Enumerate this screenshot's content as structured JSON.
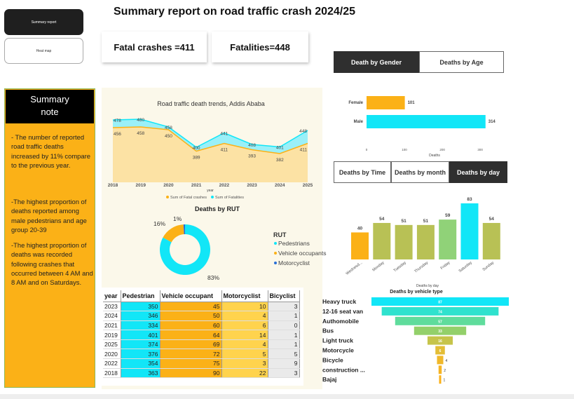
{
  "nav": {
    "summary_label": "Summary report",
    "heatmap_label": "Heat map"
  },
  "title": "Summary report on road traffic crash 2024/25",
  "cards": {
    "fatal_crashes": "Fatal crashes =411",
    "fatalities": "Fatalities=448"
  },
  "tabs_gender_age": {
    "gender": "Death by Gender",
    "age": "Deaths by Age"
  },
  "tabs_time": {
    "time": "Deaths by Time",
    "month": "Deaths by month",
    "day": "Deaths by day"
  },
  "summary": {
    "heading": "Summary note",
    "p1": "- The number of reported road traffic deaths increased by 11% compare to the previous year.",
    "p2": "-The highest proportion of deaths reported among male pedestrians and age group 20-39",
    "p3": "-The highest proportion of deaths was recorded following crashes that occurred between 4 AM and 8 AM and on Saturdays."
  },
  "colors": {
    "cyan": "#12e6f7",
    "amber": "#fbb117",
    "olive": "#b8c155",
    "green": "#90d278"
  },
  "chart_data": [
    {
      "type": "area",
      "title": "Road traffic death trends, Addis Ababa",
      "xlabel": "year",
      "x": [
        "2018",
        "2019",
        "2020",
        "2021",
        "2022",
        "2023",
        "2024",
        "2025"
      ],
      "series": [
        {
          "name": "Sum of Fatal crashes",
          "values": [
            456,
            458,
            450,
            389,
            411,
            393,
            382,
            411
          ]
        },
        {
          "name": "Sum of Fatalities",
          "values": [
            478,
            480,
            458,
            400,
            441,
            408,
            401,
            448
          ]
        }
      ],
      "legend": "bottom"
    },
    {
      "type": "pie",
      "title": "Deaths by RUT",
      "legend_title": "RUT",
      "categories": [
        "Pedestrians",
        "Vehicle occupants",
        "Motorcyclist"
      ],
      "values": [
        83,
        16,
        1
      ],
      "labels": [
        "83%",
        "16%",
        "1%"
      ]
    },
    {
      "type": "bar",
      "orientation": "horizontal",
      "categories": [
        "Female",
        "Male"
      ],
      "values": [
        101,
        314
      ],
      "xlabel": "Deaths",
      "xticks": [
        "0",
        "100",
        "200",
        "300"
      ],
      "xlim": [
        0,
        320
      ]
    },
    {
      "type": "bar",
      "xlabel": "Deaths by day",
      "categories": [
        "Wednesd...",
        "Monday",
        "Tuesday",
        "Thursday",
        "Friday",
        "Saturday",
        "Sunday"
      ],
      "values": [
        40,
        54,
        51,
        51,
        59,
        83,
        54
      ]
    },
    {
      "type": "bar",
      "orientation": "funnel",
      "title": "Deaths by vehicle type",
      "categories": [
        "Heavy truck",
        "12-16 seat van",
        "Authomobile",
        "Bus",
        "Light truck",
        "Motorcycle",
        "Bicycle",
        "construction ...",
        "Bajaj"
      ],
      "values": [
        87,
        74,
        57,
        33,
        16,
        6,
        4,
        2,
        1
      ]
    },
    {
      "type": "table",
      "columns": [
        "year",
        "Pedestrian",
        "Vehicle occupant",
        "Motorcyclist",
        "Bicyclist"
      ],
      "rows": [
        [
          "2023",
          "350",
          "45",
          "10",
          "3"
        ],
        [
          "2024",
          "346",
          "50",
          "4",
          "1"
        ],
        [
          "2021",
          "334",
          "60",
          "6",
          "0"
        ],
        [
          "2019",
          "401",
          "64",
          "14",
          "1"
        ],
        [
          "2025",
          "374",
          "69",
          "4",
          "1"
        ],
        [
          "2020",
          "376",
          "72",
          "5",
          "5"
        ],
        [
          "2022",
          "354",
          "75",
          "3",
          "9"
        ],
        [
          "2018",
          "363",
          "90",
          "22",
          "3"
        ]
      ]
    }
  ]
}
